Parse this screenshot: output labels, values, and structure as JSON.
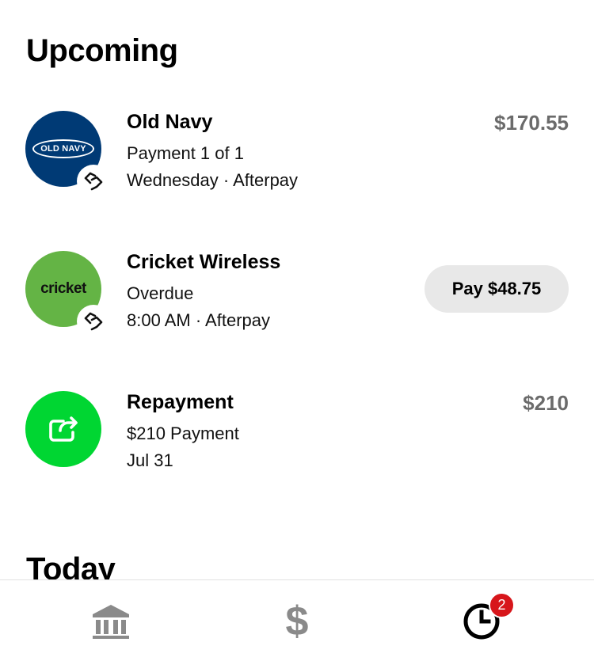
{
  "upcoming": {
    "title": "Upcoming",
    "items": [
      {
        "merchant": "Old Navy",
        "logo_text": "OLD NAVY",
        "line1": "Payment 1 of 1",
        "line2": "Wednesday · Afterpay",
        "amount": "$170.55",
        "logo_color": "#003a75",
        "badge_icon": "afterpay-icon"
      },
      {
        "merchant": "Cricket Wireless",
        "logo_text": "cricket",
        "line1": "Overdue",
        "line2": "8:00 AM · Afterpay",
        "action_label": "Pay $48.75",
        "logo_color": "#64b445",
        "badge_icon": "afterpay-icon"
      },
      {
        "merchant": "Repayment",
        "line1": "$210 Payment",
        "line2": "Jul 31",
        "amount": "$210",
        "logo_color": "#00d632",
        "icon": "repeat-arrow-icon"
      }
    ]
  },
  "today": {
    "title": "Today"
  },
  "tabbar": {
    "tabs": [
      {
        "name": "banking",
        "icon": "bank-icon"
      },
      {
        "name": "money",
        "glyph": "$",
        "icon": "dollar-icon"
      },
      {
        "name": "activity",
        "icon": "clock-icon",
        "active": true
      }
    ],
    "notification_count": "2",
    "notification_color": "#d7161b"
  }
}
